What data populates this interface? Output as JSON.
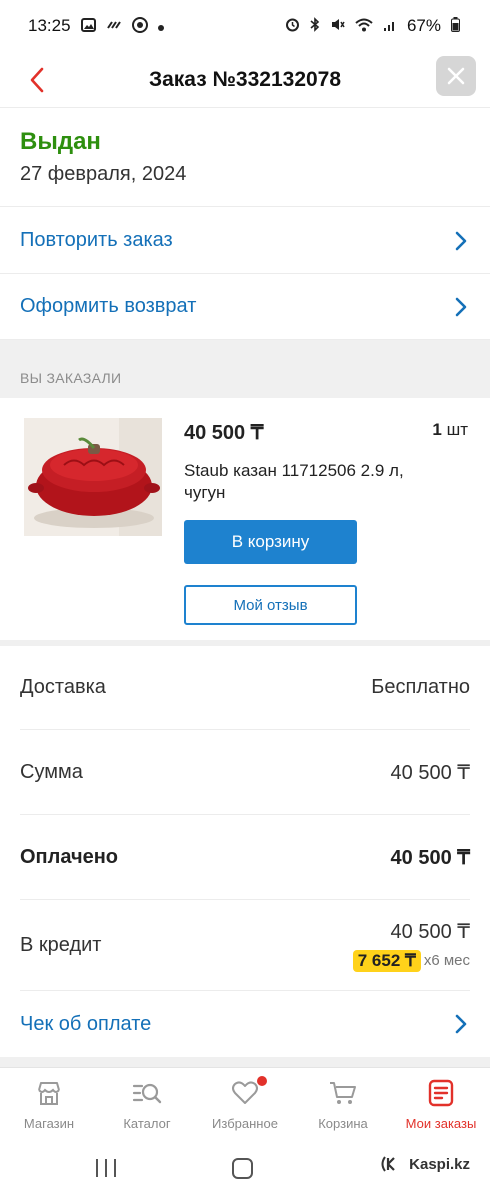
{
  "status_bar": {
    "time": "13:25",
    "battery": "67%"
  },
  "header": {
    "title": "Заказ №332132078"
  },
  "order": {
    "status": "Выдан",
    "date": "27 февраля, 2024"
  },
  "actions": {
    "repeat_label": "Повторить заказ",
    "return_label": "Оформить возврат"
  },
  "section": {
    "ordered_title": "ВЫ ЗАКАЗАЛИ"
  },
  "product": {
    "price": "40 500 ₸",
    "qty_number": "1",
    "qty_unit": "шт",
    "name": "Staub казан 11712506 2.9 л, чугун",
    "cart_button": "В корзину",
    "review_button": "Мой отзыв"
  },
  "summary": {
    "delivery_label": "Доставка",
    "delivery_value": "Бесплатно",
    "sum_label": "Сумма",
    "sum_value": "40 500 ₸",
    "paid_label": "Оплачено",
    "paid_value": "40 500 ₸",
    "credit_label": "В кредит",
    "credit_value": "40 500 ₸",
    "monthly_amount": "7 652 ₸",
    "monthly_term": "x6 мес",
    "receipt_label": "Чек об оплате"
  },
  "bottom_nav": {
    "items": [
      {
        "label": "Магазин",
        "icon": "shop-icon"
      },
      {
        "label": "Каталог",
        "icon": "catalog-search-icon"
      },
      {
        "label": "Избранное",
        "icon": "heart-icon"
      },
      {
        "label": "Корзина",
        "icon": "cart-icon"
      },
      {
        "label": "Мои заказы",
        "icon": "orders-icon"
      }
    ]
  },
  "watermark": "Kaspi.kz",
  "colors": {
    "accent": "#1e82cf",
    "status_green": "#2e8f0f",
    "active_red": "#e2312a",
    "highlight_yellow": "#ffd21a"
  }
}
